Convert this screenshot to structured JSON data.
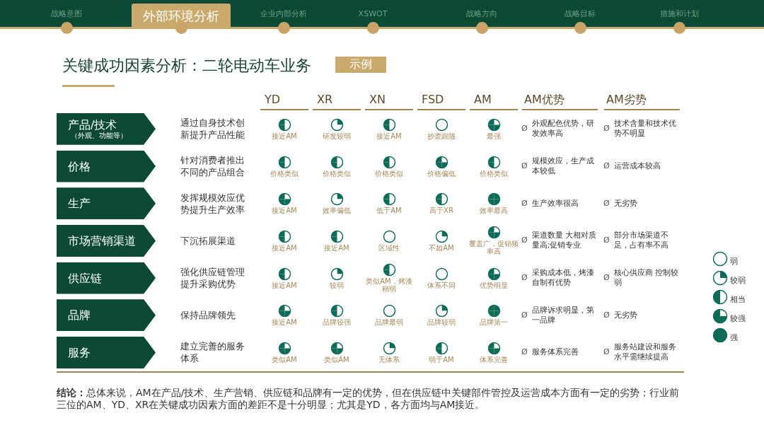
{
  "nav": [
    {
      "label": "战略意图",
      "selected": false
    },
    {
      "label": "外部环境分析",
      "selected": true
    },
    {
      "label": "企业内部分析",
      "selected": false
    },
    {
      "label": "XSWOT",
      "selected": false
    },
    {
      "label": "战略方向",
      "selected": false
    },
    {
      "label": "战略目标",
      "selected": false
    },
    {
      "label": "措施和计划",
      "selected": false
    }
  ],
  "title": "关键成功因素分析：二轮电动车业务",
  "badge": "示例",
  "table": {
    "columns": [
      "YD",
      "XR",
      "XN",
      "FSD",
      "AM",
      "AM优势",
      "AM劣势"
    ],
    "rows": [
      {
        "factor": "产品/技术",
        "factor_note": "（外观、功能等）",
        "description": "通过自身技术创新提升产品性能",
        "ratings": [
          {
            "quarters": [
              false,
              false,
              true,
              true
            ],
            "note": "接近AM"
          },
          {
            "quarters": [
              true,
              false,
              false,
              false
            ],
            "note": "研发较弱"
          },
          {
            "quarters": [
              false,
              false,
              true,
              true
            ],
            "note": "接近AM"
          },
          {
            "quarters": [
              false,
              false,
              false,
              false
            ],
            "note": "抄袭跟随"
          },
          {
            "quarters": [
              false,
              true,
              true,
              true
            ],
            "note": "最强"
          }
        ],
        "advantage": {
          "bullet": "Ø",
          "text": "外观配色优势，研发效率高"
        },
        "disadvantage": {
          "bullet": "Ø",
          "text": "技术含量和技术优势不明显"
        }
      },
      {
        "factor": "价格",
        "description": "针对消费者推出不同的产品组合",
        "ratings": [
          {
            "quarters": [
              false,
              false,
              true,
              true
            ],
            "note": "价格类似"
          },
          {
            "quarters": [
              false,
              false,
              true,
              true
            ],
            "note": "价格类似"
          },
          {
            "quarters": [
              false,
              false,
              true,
              true
            ],
            "note": "价格类似"
          },
          {
            "quarters": [
              false,
              true,
              true,
              true
            ],
            "note": "价格偏低"
          },
          {
            "quarters": [
              false,
              false,
              true,
              true
            ],
            "note": "价格类似"
          }
        ],
        "advantage": {
          "bullet": "Ø",
          "text": "规模效应，生产成本较低"
        },
        "disadvantage": {
          "bullet": "Ø",
          "text": "运营成本较高"
        }
      },
      {
        "factor": "生产",
        "description": "发挥规模效应优势提升生产效率",
        "ratings": [
          {
            "quarters": [
              false,
              true,
              true,
              true
            ],
            "note": "接近AM"
          },
          {
            "quarters": [
              true,
              false,
              false,
              false
            ],
            "note": "效率偏低"
          },
          {
            "quarters": [
              false,
              false,
              true,
              true
            ],
            "note": "低于AM"
          },
          {
            "quarters": [
              false,
              false,
              true,
              true
            ],
            "note": "高于XR"
          },
          {
            "quarters": [
              true,
              true,
              true,
              true
            ],
            "note": "效率最高"
          }
        ],
        "advantage": {
          "bullet": "Ø",
          "text": "生产效率很高"
        },
        "disadvantage": {
          "bullet": "Ø",
          "text": "无劣势"
        }
      },
      {
        "factor": "市场营销渠道",
        "description": "下沉拓展渠道",
        "ratings": [
          {
            "quarters": [
              false,
              false,
              true,
              true
            ],
            "note": "接近AM"
          },
          {
            "quarters": [
              false,
              false,
              true,
              true
            ],
            "note": "接近AM"
          },
          {
            "quarters": [
              false,
              false,
              false,
              false
            ],
            "note": "区域性"
          },
          {
            "quarters": [
              true,
              false,
              false,
              false
            ],
            "note": "不如AM"
          },
          {
            "quarters": [
              false,
              true,
              true,
              true
            ],
            "note": "覆盖广，促销频率高"
          }
        ],
        "advantage": {
          "bullet": "Ø",
          "text": "渠道数量 大相对质量高;促销专业"
        },
        "disadvantage": {
          "bullet": "Ø",
          "text": "部分市场渠道不足，占有率不高"
        }
      },
      {
        "factor": "供应链",
        "description": "强化供应链管理提升采购优势",
        "ratings": [
          {
            "quarters": [
              false,
              false,
              true,
              true
            ],
            "note": "接近AM"
          },
          {
            "quarters": [
              true,
              false,
              false,
              false
            ],
            "note": "较弱"
          },
          {
            "quarters": [
              false,
              false,
              true,
              true
            ],
            "note": "类似AM，烤漆稍弱"
          },
          {
            "quarters": [
              false,
              false,
              false,
              false
            ],
            "note": "体系不同"
          },
          {
            "quarters": [
              false,
              true,
              true,
              true
            ],
            "note": "优势明显"
          }
        ],
        "advantage": {
          "bullet": "Ø",
          "text": "采购成本低，烤漆自制有优势"
        },
        "disadvantage": {
          "bullet": "Ø",
          "text": "核心供应商 控制较弱"
        }
      },
      {
        "factor": "品牌",
        "description": "保持品牌领先",
        "ratings": [
          {
            "quarters": [
              false,
              true,
              true,
              true
            ],
            "note": "接近AM"
          },
          {
            "quarters": [
              false,
              false,
              true,
              true
            ],
            "note": "品牌较强"
          },
          {
            "quarters": [
              false,
              false,
              false,
              false
            ],
            "note": "品牌最弱"
          },
          {
            "quarters": [
              true,
              false,
              false,
              false
            ],
            "note": "品牌较弱"
          },
          {
            "quarters": [
              true,
              true,
              true,
              true
            ],
            "note": "品牌第一"
          }
        ],
        "advantage": {
          "bullet": "Ø",
          "text": "品牌诉求明显，第一品牌"
        },
        "disadvantage": {
          "bullet": "Ø",
          "text": "无劣势"
        }
      },
      {
        "factor": "服务",
        "description": "建立完善的服务体系",
        "ratings": [
          {
            "quarters": [
              false,
              true,
              true,
              true
            ],
            "note": "类似AM"
          },
          {
            "quarters": [
              false,
              true,
              true,
              true
            ],
            "note": "类似AM"
          },
          {
            "quarters": [
              true,
              false,
              false,
              false
            ],
            "note": "无体系"
          },
          {
            "quarters": [
              false,
              false,
              true,
              true
            ],
            "note": "弱于AM"
          },
          {
            "quarters": [
              false,
              true,
              true,
              true
            ],
            "note": "体系完善"
          }
        ],
        "advantage": {
          "bullet": "Ø",
          "text": "服务体系完善"
        },
        "disadvantage": {
          "bullet": "Ø",
          "text": "服务站建设和服务水平需继续提高"
        }
      }
    ]
  },
  "legend": [
    {
      "quarters": [
        false,
        false,
        false,
        false
      ],
      "label": "弱"
    },
    {
      "quarters": [
        true,
        false,
        false,
        false
      ],
      "label": "较弱"
    },
    {
      "quarters": [
        false,
        false,
        true,
        true
      ],
      "label": "相当"
    },
    {
      "quarters": [
        false,
        true,
        true,
        true
      ],
      "label": "较强"
    },
    {
      "quarters": [
        true,
        true,
        true,
        true
      ],
      "label": "强"
    }
  ],
  "conclusion": "**结论：**总体来说，AM在产品/技术、生产营销、供应链和品牌有一定的优势，但在供应链中关键部件管控及运营成本方面有一定的劣势；行业前三位的AM、YD、XR在关键成功因素方面的差距不是十分明显；尤其是YD，各方面均与AM接近。"
}
